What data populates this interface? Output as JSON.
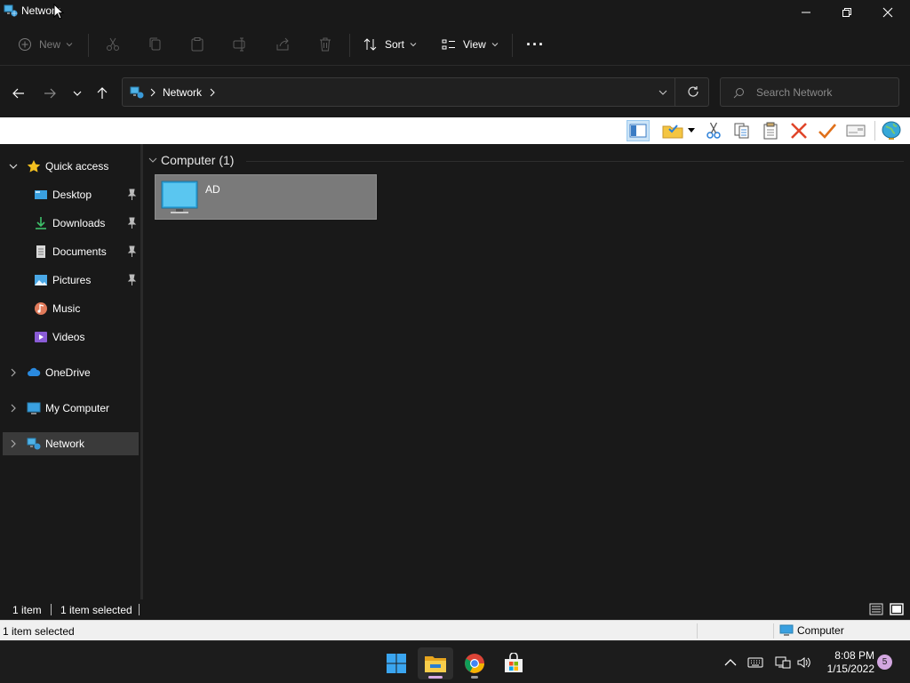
{
  "window": {
    "title": "Network",
    "controls": [
      "minimize-icon",
      "maximize-icon",
      "close-icon"
    ]
  },
  "commandbar": {
    "new_label": "New",
    "sort_label": "Sort",
    "view_label": "View",
    "more_label": "···",
    "disabled_actions": [
      "cut-icon",
      "copy-icon",
      "paste-icon",
      "rename-icon",
      "share-icon",
      "delete-icon"
    ]
  },
  "addressbar": {
    "breadcrumb": "Network",
    "search_placeholder": "Search Network"
  },
  "toolstrip": {
    "icons": [
      "preview-pane-icon",
      "folder-options-icon",
      "cut-icon",
      "copy-icon",
      "paste-icon",
      "delete-icon",
      "check-icon",
      "properties-icon",
      "globe-icon"
    ]
  },
  "sidebar": {
    "items": [
      {
        "label": "Quick access",
        "icon": "star-icon"
      },
      {
        "label": "Desktop",
        "icon": "desktop-icon",
        "pinned": true
      },
      {
        "label": "Downloads",
        "icon": "download-icon",
        "pinned": true
      },
      {
        "label": "Documents",
        "icon": "documents-icon",
        "pinned": true
      },
      {
        "label": "Pictures",
        "icon": "pictures-icon",
        "pinned": true
      },
      {
        "label": "Music",
        "icon": "music-icon"
      },
      {
        "label": "Videos",
        "icon": "videos-icon"
      },
      {
        "label": "OneDrive",
        "icon": "cloud-icon"
      },
      {
        "label": "My Computer",
        "icon": "computer-icon"
      },
      {
        "label": "Network",
        "icon": "network-icon",
        "selected": true
      }
    ]
  },
  "content": {
    "group_label": "Computer (1)",
    "items": [
      {
        "name": "AD",
        "icon": "computer-icon",
        "selected": true
      }
    ]
  },
  "statusbar": {
    "item_count": "1 item",
    "selection": "1 item selected"
  },
  "classicbar": {
    "selection": "1 item selected",
    "zone": "Computer"
  },
  "taskbar": {
    "apps": [
      "windows-start-icon",
      "file-explorer-icon",
      "chrome-icon",
      "store-icon"
    ],
    "time": "8:08 PM",
    "date": "1/15/2022",
    "notification_count": "5"
  },
  "colors": {
    "background": "#191919",
    "selection": "#3a3a3a",
    "tile_selected": "#7a7a7a",
    "accent_folder": "#f4c542",
    "accent_blue": "#3aa0e0"
  }
}
